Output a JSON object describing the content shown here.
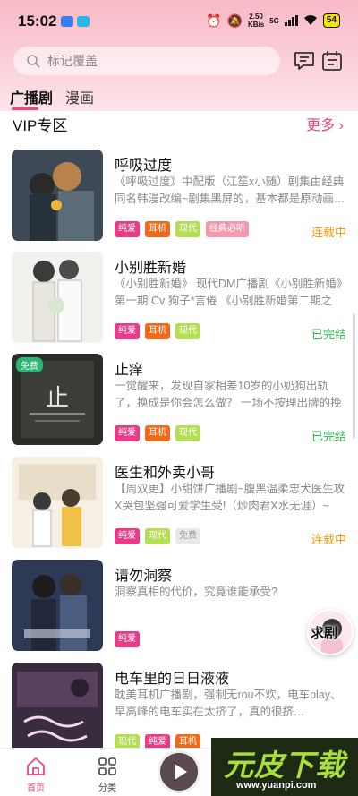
{
  "status_bar": {
    "time": "15:02",
    "net_speed_value": "2.50",
    "net_speed_unit": "KB/s",
    "signal": "5G",
    "battery": "54"
  },
  "search": {
    "placeholder": "标记覆盖"
  },
  "tabs": [
    {
      "label": "广播剧",
      "active": true
    },
    {
      "label": "漫画",
      "active": false
    }
  ],
  "section": {
    "title": "VIP专区",
    "more": "更多"
  },
  "items": [
    {
      "title": "呼吸过度",
      "desc": "《呼吸过度》中配版（江笙x小随）剧集由经典同名韩漫改编~剧集黑屏的，基本都是原动画…",
      "tags": [
        "纯爱",
        "耳机",
        "现代",
        "经典必听"
      ],
      "status": "连载中",
      "free": ""
    },
    {
      "title": "小别胜新婚",
      "desc": "《小别胜新婚》 现代DM广播剧《小别胜新婚》第一期 Cv 狗子*言倦 《小别胜新婚第二期之g…",
      "tags": [
        "纯爱",
        "耳机",
        "现代"
      ],
      "status": "已完结",
      "free": ""
    },
    {
      "title": "止痒",
      "desc": "一觉醒来，发现自家相差10岁的小奶狗出轨了，换成是你会怎么做？ 一场不按理出牌的挽尊大…",
      "tags": [
        "纯爱",
        "耳机",
        "现代"
      ],
      "status": "已完结",
      "free": "免费"
    },
    {
      "title": "医生和外卖小哥",
      "desc": "【周双更】小甜饼广播剧~腹黑温柔忠犬医生攻X哭包坚强可爱学生受!（炒肉君X水无涯）~听…",
      "tags": [
        "纯爱",
        "现代",
        "免费"
      ],
      "status": "连载中",
      "free": ""
    },
    {
      "title": "请勿洞察",
      "desc": "洞察真相的代价，究竟谁能承受?",
      "tags": [
        "纯爱"
      ],
      "status": "",
      "free": ""
    },
    {
      "title": "电车里的日日液液",
      "desc": "耽美耳机广播剧，强制无rou不欢，电车play、早高峰的电车实在太挤了，真的很挤…",
      "tags": [
        "现代",
        "纯爱",
        "耳机"
      ],
      "status": "",
      "free": ""
    }
  ],
  "float_button": "求剧",
  "bottom_nav": [
    {
      "label": "首页",
      "active": true
    },
    {
      "label": "分类",
      "active": false
    }
  ],
  "watermark": {
    "main": "元皮下载",
    "url": "www.yuanpi.com"
  },
  "colors": {
    "accent": "#e8477a",
    "status_ongoing": "#f29c11",
    "status_done": "#2fb64a",
    "tag_pure": "#e93b88",
    "tag_earphone": "#f06a1a",
    "tag_modern": "#b3de55",
    "tag_classic": "#f49aae",
    "tag_free": "#e8e8e8"
  }
}
